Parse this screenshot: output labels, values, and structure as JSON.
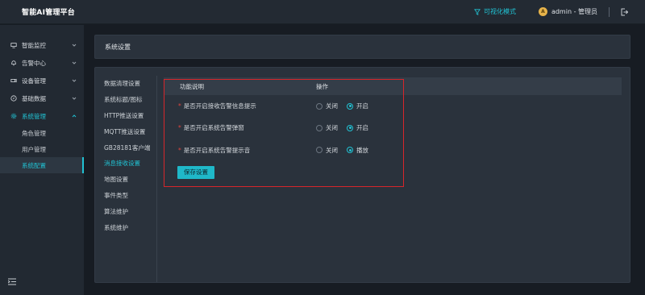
{
  "app": {
    "title": "智能AI管理平台"
  },
  "header": {
    "visual_mode": "可视化模式",
    "user": "admin - 管理员",
    "avatar_letter": "A"
  },
  "sidebar": {
    "items": [
      {
        "label": "智能监控",
        "icon": "monitor-icon"
      },
      {
        "label": "告警中心",
        "icon": "bell-icon"
      },
      {
        "label": "设备管理",
        "icon": "camera-icon"
      },
      {
        "label": "基础数据",
        "icon": "compass-icon"
      },
      {
        "label": "系统管理",
        "icon": "gear-icon",
        "open": true
      }
    ],
    "sub_items": [
      {
        "label": "角色管理"
      },
      {
        "label": "用户管理"
      },
      {
        "label": "系统配置",
        "active": true
      }
    ]
  },
  "page": {
    "title": "系统设置"
  },
  "settings_nav": [
    "数据清理设置",
    "系统标题/图标",
    "HTTP推送设置",
    "MQTT推送设置",
    "GB28181客户端",
    "消息接收设置",
    "地图设置",
    "事件类型",
    "算法维护",
    "系统维护"
  ],
  "settings_nav_active": "消息接收设置",
  "table": {
    "col_desc": "功能说明",
    "col_op": "操作",
    "rows": [
      {
        "desc": "是否开启接收告警信息提示",
        "off": "关闭",
        "on": "开启",
        "selected": "on"
      },
      {
        "desc": "是否开启系统告警弹窗",
        "off": "关闭",
        "on": "开启",
        "selected": "on"
      },
      {
        "desc": "是否开启系统告警提示音",
        "off": "关闭",
        "on": "播放",
        "selected": "on"
      }
    ],
    "required_mark": "*"
  },
  "save_button": "保存设置",
  "colors": {
    "accent": "#21c2d3",
    "highlight": "#d6262b",
    "required": "#e0443e"
  }
}
